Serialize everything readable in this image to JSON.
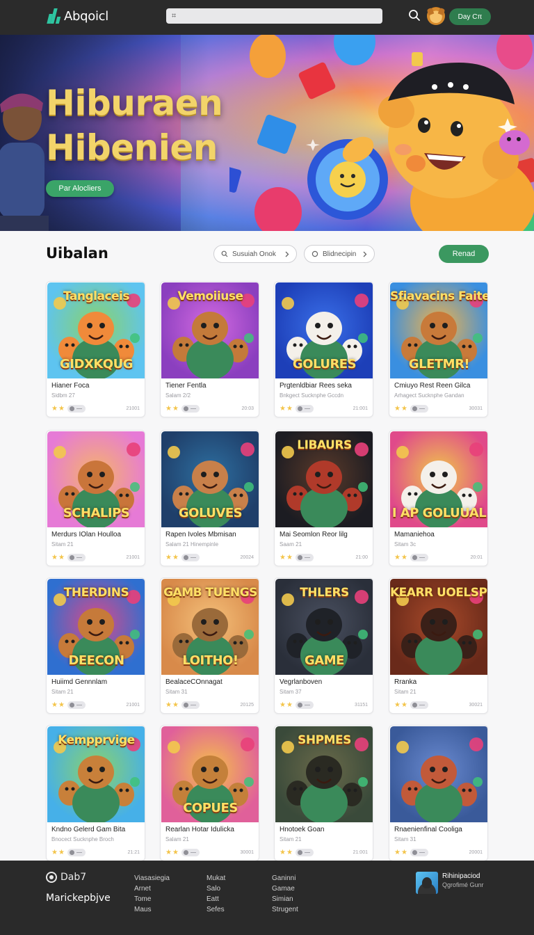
{
  "brand": {
    "name": "Abqoicl",
    "accent": "#2ec4a0"
  },
  "header": {
    "search_placeholder": "",
    "search_value": "⌗",
    "cta_label": "Day Cπ"
  },
  "hero": {
    "title_line1": "Hiburaen",
    "title_line2": "Hibenien",
    "button_label": "Par Alocliers"
  },
  "section": {
    "title": "Uibalan",
    "filter_1": "Susuiah Onok",
    "filter_2": "Blidnecipin",
    "action_label": "Renad"
  },
  "cards": [
    {
      "title": "Hianer Foca",
      "subtitle": "Sidbm 27",
      "count": "21001",
      "art_top": "Tanglaceis",
      "art_bottom": "GIDXKQUG"
    },
    {
      "title": "Tiener Fentla",
      "subtitle": "Salam 2/2",
      "count": "20:03",
      "art_top": "Vemoiiuse",
      "art_bottom": ""
    },
    {
      "title": "Prgtenldbiar Rees seka",
      "subtitle": "Bnkgect Sucknphe Gccdn",
      "count": "21:001",
      "art_top": "",
      "art_bottom": "GOLURES"
    },
    {
      "title": "Cmiuyo Rest Reen Gilca",
      "subtitle": "Arhagect Sucknphe Gandan",
      "count": "30031",
      "art_top": "Sfiavacins Faiteris",
      "art_bottom": "GLETMR!"
    },
    {
      "title": "Merdurs IOlan Houlloa",
      "subtitle": "Sitam 21",
      "count": "21001",
      "art_top": "",
      "art_bottom": "SCHALIPS"
    },
    {
      "title": "Rapen Ivoles Mbmisan",
      "subtitle": "Salam 21 Hinempinle",
      "count": "20024",
      "art_top": "",
      "art_bottom": "GOLUVES"
    },
    {
      "title": "Mai Seomlon Reor lilg",
      "subtitle": "Saam 21",
      "count": "21:00",
      "art_top": "LIBAURS",
      "art_bottom": ""
    },
    {
      "title": "Mamaniehoa",
      "subtitle": "Sitam 3c",
      "count": "20:01",
      "art_top": "",
      "art_bottom": "I AP GOLUUAL"
    },
    {
      "title": "Huiimd Gennnlam",
      "subtitle": "Sitam 21",
      "count": "21001",
      "art_top": "THERDINS",
      "art_bottom": "DEECON"
    },
    {
      "title": "BealaceCOnnagat",
      "subtitle": "Sitam 31",
      "count": "20125",
      "art_top": "GAMB TUENGS",
      "art_bottom": "LOITHO!"
    },
    {
      "title": "Vegrlanboven",
      "subtitle": "Sitam 37",
      "count": "31151",
      "art_top": "THLERS",
      "art_bottom": "GAME"
    },
    {
      "title": "Rranka",
      "subtitle": "Sitam 21",
      "count": "30021",
      "art_top": "KEARR UOELSPRH",
      "art_bottom": ""
    },
    {
      "title": "Kndno Gelerd Gam Bita",
      "subtitle": "Bnocect Sucknphe Broch",
      "count": "21:21",
      "art_top": "Kempprvige",
      "art_bottom": ""
    },
    {
      "title": "Rearlan Hotar Idulicka",
      "subtitle": "Salam 21",
      "count": "30001",
      "art_top": "",
      "art_bottom": "COPUES"
    },
    {
      "title": "Hnotoek Goan",
      "subtitle": "Sitam 21",
      "count": "21:001",
      "art_top": "SHPMES",
      "art_bottom": ""
    },
    {
      "title": "Rnaenienfinal Cooliga",
      "subtitle": "Sitam 31",
      "count": "20001",
      "art_top": "",
      "art_bottom": ""
    }
  ],
  "footer": {
    "brand": "Dab7",
    "tagline": "Marickepbjve",
    "col1": [
      "Viasasiegia",
      "Arnet",
      "Tome",
      "Maus"
    ],
    "col2": [
      "Mukat",
      "Salo",
      "Eatt",
      "Sefes"
    ],
    "col3": [
      "Ganinni",
      "Gamae",
      "Simian",
      "Strugent"
    ],
    "user_name": "Rihinipaciod",
    "user_sub": "Qgrofimé Gunr"
  },
  "colors": {
    "green": "#3b9860",
    "topbar": "#2b2b2b",
    "footer": "#2a2a2a",
    "hero_title": "#f2d46a"
  }
}
